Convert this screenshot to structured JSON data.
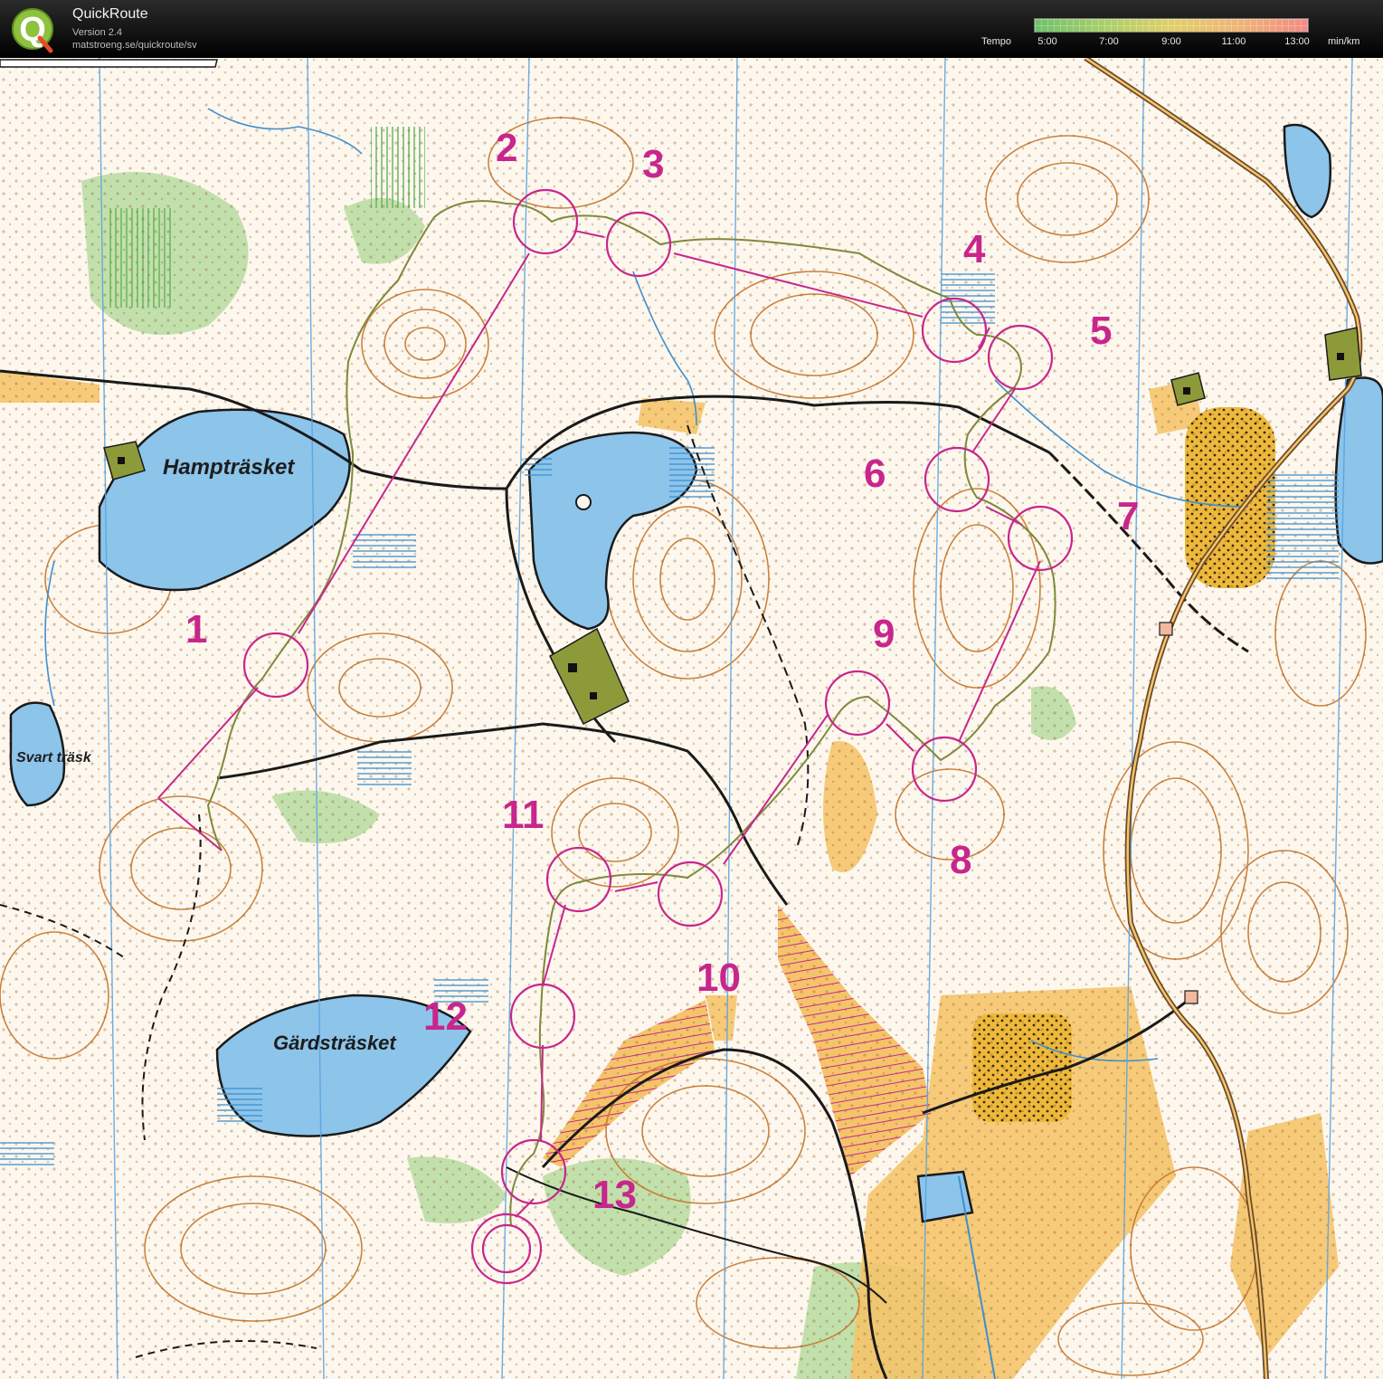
{
  "app": {
    "title": "QuickRoute",
    "version": "Version 2.4",
    "url": "matstroeng.se/quickroute/sv"
  },
  "legend": {
    "label": "Tempo",
    "unit": "min/km",
    "ticks": [
      "5:00",
      "7:00",
      "9:00",
      "11:00",
      "13:00"
    ]
  },
  "map": {
    "lake_labels": [
      "Hampträsket",
      "Svart träsk",
      "Gärdsträsket"
    ],
    "controls": [
      "1",
      "2",
      "3",
      "4",
      "5",
      "6",
      "7",
      "8",
      "9",
      "10",
      "11",
      "12",
      "13"
    ],
    "colors": {
      "course": "#c8268c",
      "route": "#7d8a3a",
      "water": "#8cc4ea",
      "contour": "#c6762b",
      "open_land": "#f3c46f",
      "vegetation": "#a8d48a",
      "magnetic_north": "#5aa4e0",
      "paths": "#1a1a1a"
    }
  }
}
